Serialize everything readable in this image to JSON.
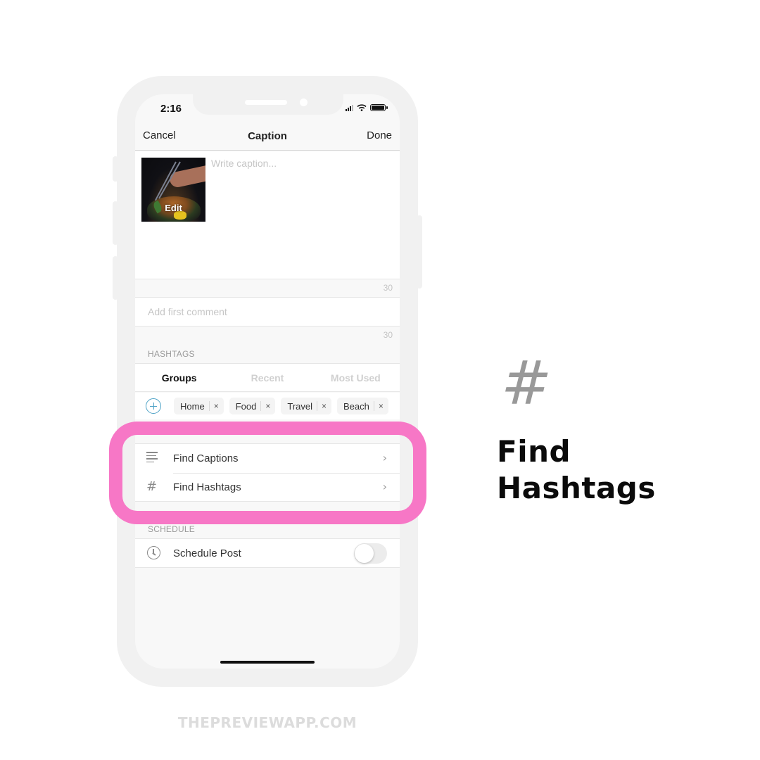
{
  "status_bar": {
    "time": "2:16",
    "signal_icon": "cellular-signal-icon",
    "wifi_icon": "wifi-icon",
    "battery_icon": "battery-icon"
  },
  "navbar": {
    "cancel_label": "Cancel",
    "title": "Caption",
    "done_label": "Done"
  },
  "caption": {
    "thumbnail_overlay_label": "Edit",
    "placeholder": "Write caption...",
    "value": "",
    "remaining_count": "30"
  },
  "first_comment": {
    "placeholder": "Add first comment",
    "value": "",
    "remaining_count": "30"
  },
  "hashtags": {
    "section_label": "HASHTAGS",
    "tabs": [
      {
        "label": "Groups",
        "active": true
      },
      {
        "label": "Recent",
        "active": false
      },
      {
        "label": "Most Used",
        "active": false
      }
    ],
    "add_icon": "add-circle-icon",
    "groups": [
      {
        "label": "Home"
      },
      {
        "label": "Food"
      },
      {
        "label": "Travel"
      },
      {
        "label": "Beach"
      }
    ],
    "remove_glyph": "×"
  },
  "menu": {
    "items": [
      {
        "label": "Find Captions",
        "icon": "text-lines-icon"
      },
      {
        "label": "Find Hashtags",
        "icon": "hashtag-icon"
      }
    ],
    "chevron_glyph": "›"
  },
  "schedule": {
    "section_label": "SCHEDULE",
    "row_label": "Schedule Post",
    "toggle_on": false
  },
  "annotation": {
    "highlight_color": "#f777c6",
    "hash_glyph": "#",
    "headline_line1": "Find",
    "headline_line2": "Hashtags"
  },
  "footer": {
    "brand": "THEPREVIEWAPP.COM"
  }
}
